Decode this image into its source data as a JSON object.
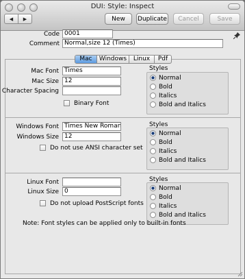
{
  "window": {
    "title": "DUI: Style: Inspect"
  },
  "toolbar": {
    "back_icon": "◀",
    "forward_icon": "▶",
    "new_label": "New",
    "duplicate_label": "Duplicate",
    "cancel_label": "Cancel",
    "save_label": "Save"
  },
  "record": {
    "code_label": "Code",
    "code_value": "0001",
    "comment_label": "Comment",
    "comment_value": "Normal,size 12 (Times)"
  },
  "tabs": [
    "Mac",
    "Windows",
    "Linux",
    "Pdf"
  ],
  "active_tab": "Mac",
  "styles_title": "Styles",
  "style_options": [
    "Normal",
    "Bold",
    "Italics",
    "Bold and Italics"
  ],
  "mac": {
    "font_label": "Mac Font",
    "font_value": "Times",
    "size_label": "Mac Size",
    "size_value": "12",
    "spacing_label": "Character Spacing",
    "spacing_value": "",
    "binary_label": "Binary Font",
    "selected_style": "Normal"
  },
  "windows": {
    "font_label": "Windows Font",
    "font_value": "Times New Roman",
    "size_label": "Windows Size",
    "size_value": "12",
    "ansi_label": "Do not use ANSI character set",
    "selected_style": "Normal"
  },
  "linux": {
    "font_label": "Linux Font",
    "font_value": "",
    "size_label": "Linux Size",
    "size_value": "0",
    "postscript_label": "Do not upload PostScript fonts",
    "selected_style": "Normal"
  },
  "note": "Note: Font styles can be applied only to built-in fonts",
  "icons": {
    "pin": "pin-icon",
    "resize": "resize-grip-icon"
  }
}
